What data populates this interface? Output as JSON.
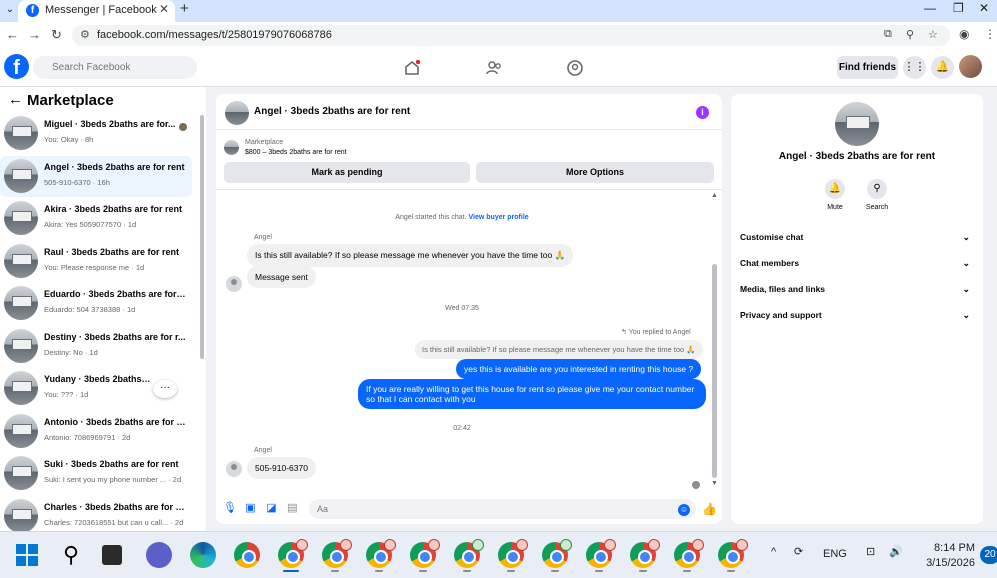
{
  "browser": {
    "tab_title": "Messenger | Facebook",
    "url": "facebook.com/messages/t/25801979076068786"
  },
  "header": {
    "search_placeholder": "Search Facebook",
    "find_friends": "Find friends"
  },
  "sidebar": {
    "title": "Marketplace",
    "conversations": [
      {
        "name": "Miguel · 3beds 2baths are for...",
        "preview": "You: Okay · 8h"
      },
      {
        "name": "Angel · 3beds 2baths are for rent",
        "preview": "505-910-6370 · 16h"
      },
      {
        "name": "Akira · 3beds 2baths are for rent",
        "preview": "Akira: Yes 5059077570 · 1d"
      },
      {
        "name": "Raul · 3beds 2baths are for rent",
        "preview": "You: Please response me · 1d"
      },
      {
        "name": "Eduardo · 3beds 2baths are for r...",
        "preview": "Eduardo: 504 3738388 · 1d"
      },
      {
        "name": "Destiny · 3beds 2baths are for r...",
        "preview": "Destiny: No · 1d"
      },
      {
        "name": "Yudany · 3beds 2baths are fo...",
        "preview": "You: ??? · 1d"
      },
      {
        "name": "Antonio · 3beds 2baths are for r...",
        "preview": "Antonio: 7086969791 · 2d"
      },
      {
        "name": "Suki · 3beds 2baths are for rent",
        "preview": "Suki: I sent you my phone number ... · 2d"
      },
      {
        "name": "Charles · 3beds 2baths are for re...",
        "preview": "Charles: 7203618551 but can u call... · 2d"
      }
    ],
    "more": "···"
  },
  "chat": {
    "title": "Angel · 3beds 2baths are for rent",
    "listing_label": "Marketplace",
    "listing_title": "$800 – 3beds 2baths are for rent",
    "btn_pending": "Mark as pending",
    "btn_more": "More Options",
    "started_note": "Angel started this chat.",
    "view_profile": "View buyer profile",
    "sender1": "Angel",
    "msg1": "Is this still available? If so please message me whenever you have the time too 🙏",
    "msg2": "Message sent",
    "time1": "Wed 07:35",
    "reply_note": "You replied to Angel",
    "quoted": "Is this still available? If so please message me whenever you have the time too 🙏",
    "out1": "yes this is available are you interested in renting this house ?",
    "out2": "If you are really willing to get this house for rent so please give me your contact number so that I can contact with you",
    "time2": "02:42",
    "sender2": "Angel",
    "msg3": "505-910-6370",
    "composer_placeholder": "Aa"
  },
  "rpanel": {
    "name": "Angel · 3beds 2baths are for rent",
    "mute": "Mute",
    "search": "Search",
    "rows": [
      "Customise chat",
      "Chat members",
      "Media, files and links",
      "Privacy and support"
    ]
  },
  "taskbar": {
    "lang": "ENG",
    "time": "8:14 PM",
    "date": "3/15/2026",
    "notif": "20"
  }
}
